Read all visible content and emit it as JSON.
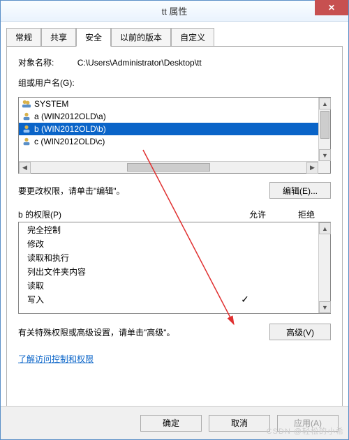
{
  "window": {
    "title": "tt 属性"
  },
  "tabs": [
    "常规",
    "共享",
    "安全",
    "以前的版本",
    "自定义"
  ],
  "activeTab": 2,
  "objectLabel": "对象名称:",
  "objectPath": "C:\\Users\\Administrator\\Desktop\\tt",
  "groupLabel": "组或用户名(G):",
  "principals": [
    {
      "icon": "users",
      "name": "SYSTEM",
      "selected": false
    },
    {
      "icon": "user",
      "name": "a (WIN2012OLD\\a)",
      "selected": false
    },
    {
      "icon": "user",
      "name": "b (WIN2012OLD\\b)",
      "selected": true
    },
    {
      "icon": "user",
      "name": "c (WIN2012OLD\\c)",
      "selected": false
    }
  ],
  "editHint": "要更改权限，请单击\"编辑\"。",
  "editBtn": "编辑(E)...",
  "permForLabel": "b 的权限(P)",
  "allowLabel": "允许",
  "denyLabel": "拒绝",
  "permissions": [
    {
      "name": "完全控制",
      "allow": false,
      "deny": false
    },
    {
      "name": "修改",
      "allow": false,
      "deny": false
    },
    {
      "name": "读取和执行",
      "allow": false,
      "deny": false
    },
    {
      "name": "列出文件夹内容",
      "allow": false,
      "deny": false
    },
    {
      "name": "读取",
      "allow": false,
      "deny": false
    },
    {
      "name": "写入",
      "allow": true,
      "deny": false
    }
  ],
  "advHint": "有关特殊权限或高级设置，请单击\"高级\"。",
  "advBtn": "高级(V)",
  "helpLink": "了解访问控制和权限",
  "footer": {
    "ok": "确定",
    "cancel": "取消",
    "apply": "应用(A)"
  },
  "watermark": "CSDN @轻松的小希"
}
